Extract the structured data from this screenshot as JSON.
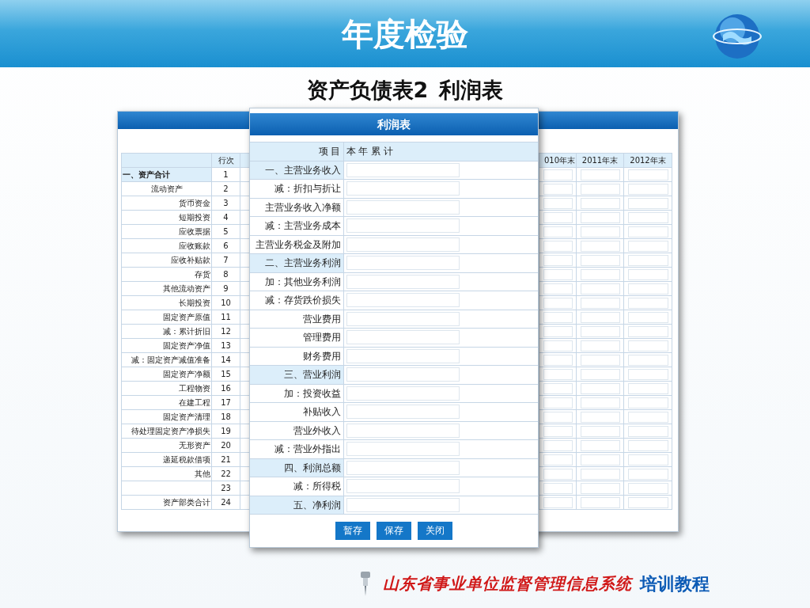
{
  "slide": {
    "title": "年度检验",
    "subtitle_back": "资产负债表2",
    "subtitle_front": "利润表",
    "footer_system": "山东省事业单位监督管理信息系统",
    "footer_tag": "培训教程"
  },
  "balance_window": {
    "row_no_heading": "行次",
    "year_headings": [
      "010年末",
      "2011年末",
      "2012年末"
    ],
    "rows": [
      {
        "label": "一、资产合计",
        "no": "1",
        "kind": "section"
      },
      {
        "label": "流动资产",
        "no": "2",
        "kind": "group"
      },
      {
        "label": "货币资金",
        "no": "3",
        "kind": "item"
      },
      {
        "label": "短期投资",
        "no": "4",
        "kind": "item"
      },
      {
        "label": "应收票据",
        "no": "5",
        "kind": "item"
      },
      {
        "label": "应收账款",
        "no": "6",
        "kind": "item"
      },
      {
        "label": "应收补贴款",
        "no": "7",
        "kind": "item"
      },
      {
        "label": "存货",
        "no": "8",
        "kind": "item"
      },
      {
        "label": "其他流动资产",
        "no": "9",
        "kind": "item"
      },
      {
        "label": "长期投资",
        "no": "10",
        "kind": "item"
      },
      {
        "label": "固定资产原值",
        "no": "11",
        "kind": "item"
      },
      {
        "label": "减：累计折旧",
        "no": "12",
        "kind": "item"
      },
      {
        "label": "固定资产净值",
        "no": "13",
        "kind": "item"
      },
      {
        "label": "减：固定资产减值准备",
        "no": "14",
        "kind": "item"
      },
      {
        "label": "固定资产净额",
        "no": "15",
        "kind": "item"
      },
      {
        "label": "工程物资",
        "no": "16",
        "kind": "item"
      },
      {
        "label": "在建工程",
        "no": "17",
        "kind": "item"
      },
      {
        "label": "固定资产清理",
        "no": "18",
        "kind": "item"
      },
      {
        "label": "待处理固定资产净损失",
        "no": "19",
        "kind": "item"
      },
      {
        "label": "无形资产",
        "no": "20",
        "kind": "item"
      },
      {
        "label": "递延税款借项",
        "no": "21",
        "kind": "item"
      },
      {
        "label": "其他",
        "no": "22",
        "kind": "item"
      },
      {
        "no": "23",
        "kind": "item"
      },
      {
        "label": "资产部类合计",
        "no": "24",
        "kind": "item"
      }
    ]
  },
  "income_dialog": {
    "title": "利润表",
    "column_item": "项 目",
    "column_value": "本 年 累 计",
    "rows": [
      {
        "label": "一、主营业务收入",
        "kind": "section"
      },
      {
        "label": "减：折扣与折让",
        "kind": "item"
      },
      {
        "label": "主营业务收入净额",
        "kind": "item"
      },
      {
        "label": "减：主营业务成本",
        "kind": "item"
      },
      {
        "label": "主营业务税金及附加",
        "kind": "item"
      },
      {
        "label": "二、主营业务利润",
        "kind": "section"
      },
      {
        "label": "加：其他业务利润",
        "kind": "item"
      },
      {
        "label": "减：存货跌价损失",
        "kind": "item"
      },
      {
        "label": "营业费用",
        "kind": "item"
      },
      {
        "label": "管理费用",
        "kind": "item"
      },
      {
        "label": "财务费用",
        "kind": "item"
      },
      {
        "label": "三、营业利润",
        "kind": "section"
      },
      {
        "label": "加：投资收益",
        "kind": "item"
      },
      {
        "label": "补贴收入",
        "kind": "item"
      },
      {
        "label": "营业外收入",
        "kind": "item"
      },
      {
        "label": "减：营业外指出",
        "kind": "item"
      },
      {
        "label": "四、利润总额",
        "kind": "section"
      },
      {
        "label": "减：所得税",
        "kind": "item"
      },
      {
        "label": "五、净利润",
        "kind": "section"
      }
    ],
    "buttons": [
      "暂存",
      "保存",
      "关闭"
    ]
  }
}
